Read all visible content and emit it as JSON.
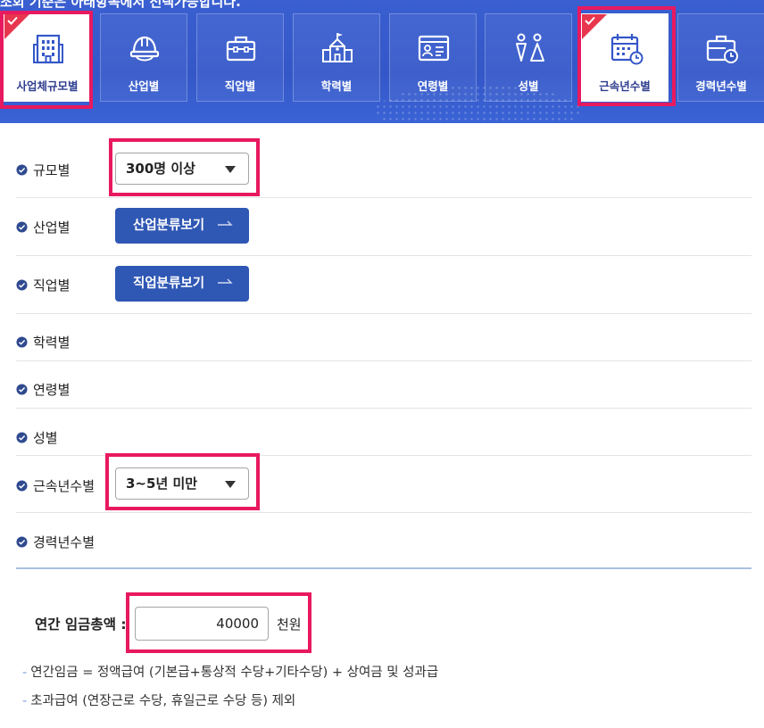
{
  "banner": {
    "top_text": "조회 기준은 아래항목에서 선택가능합니다."
  },
  "tabs": [
    {
      "label": "사업체규모별",
      "icon": "building-icon",
      "active": true
    },
    {
      "label": "산업별",
      "icon": "hardhat-icon",
      "active": false
    },
    {
      "label": "직업별",
      "icon": "toolbox-icon",
      "active": false
    },
    {
      "label": "학력별",
      "icon": "school-icon",
      "active": false
    },
    {
      "label": "연령별",
      "icon": "id-card-icon",
      "active": false
    },
    {
      "label": "성별",
      "icon": "gender-icon",
      "active": false
    },
    {
      "label": "근속년수별",
      "icon": "calendar-icon",
      "active": true
    },
    {
      "label": "경력년수별",
      "icon": "briefcase-clock-icon",
      "active": false
    }
  ],
  "form": {
    "rows": [
      {
        "label": "규모별"
      },
      {
        "label": "산업별"
      },
      {
        "label": "직업별"
      },
      {
        "label": "학력별"
      },
      {
        "label": "연령별"
      },
      {
        "label": "성별"
      },
      {
        "label": "근속년수별"
      },
      {
        "label": "경력년수별"
      }
    ],
    "size_select_value": "300명 이상",
    "industry_button": "산업분류보기",
    "occupation_button": "직업분류보기",
    "tenure_select_value": "3~5년 미만"
  },
  "wage": {
    "label": "연간 임금총액 :",
    "value": "40000",
    "unit": "천원"
  },
  "notes": [
    "연간임금 = 정액급여 (기본급+통상적 수당+기타수당) + 상여금 및 성과급",
    "초과급여 (연장근로 수당, 휴일근로 수당 등) 제외"
  ],
  "colors": {
    "banner": "#3457c8",
    "highlight": "#e8195f",
    "button": "#2f57b4",
    "check_badge": "#e8364e"
  }
}
